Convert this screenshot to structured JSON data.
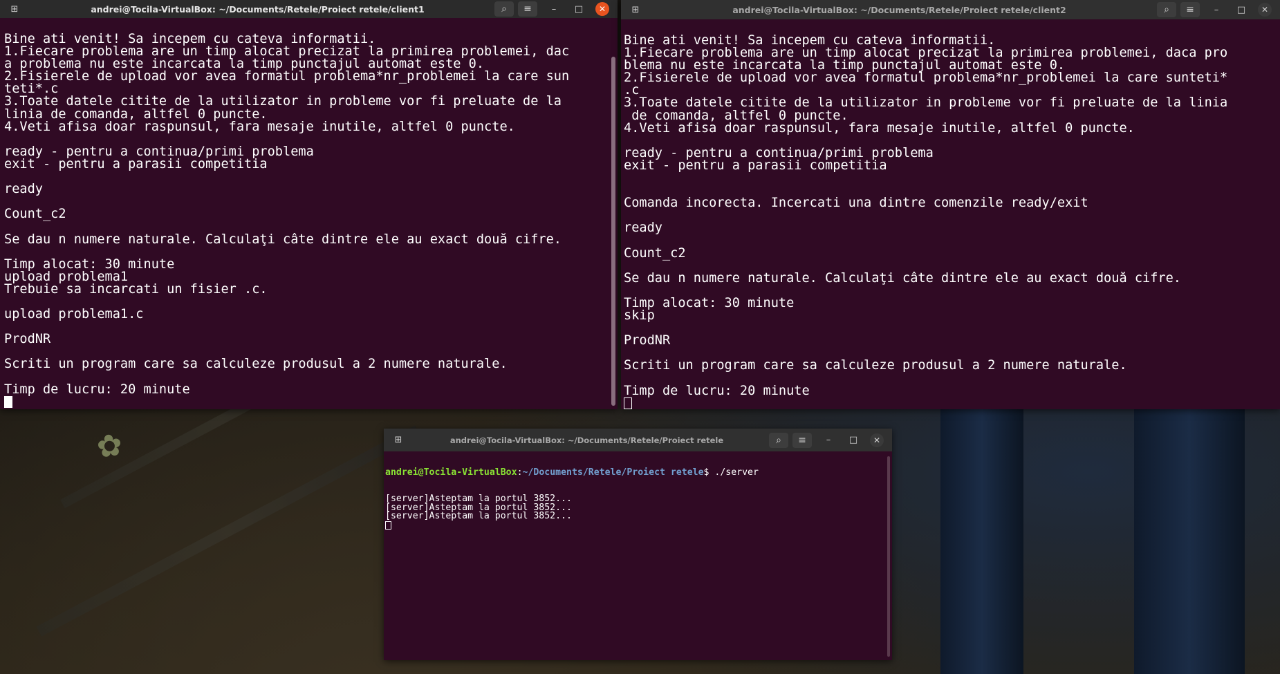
{
  "client1": {
    "title": "andrei@Tocila-VirtualBox: ~/Documents/Retele/Proiect retele/client1",
    "lines": [
      "Bine ati venit! Sa incepem cu cateva informatii.",
      "1.Fiecare problema are un timp alocat precizat la primirea problemei, dac",
      "a problema nu este incarcata la timp punctajul automat este 0.",
      "2.Fisierele de upload vor avea formatul problema*nr_problemei la care sun",
      "teti*.c",
      "3.Toate datele citite de la utilizator in probleme vor fi preluate de la",
      "linia de comanda, altfel 0 puncte.",
      "4.Veti afisa doar raspunsul, fara mesaje inutile, altfel 0 puncte.",
      "",
      "ready - pentru a continua/primi problema",
      "exit - pentru a parasii competitia",
      "",
      "ready",
      "",
      "Count_c2",
      "",
      "Se dau n numere naturale. Calculaţi câte dintre ele au exact două cifre.",
      "",
      "Timp alocat: 30 minute",
      "upload problema1",
      "Trebuie sa incarcati un fisier .c.",
      "",
      "upload problema1.c",
      "",
      "ProdNR",
      "",
      "Scriti un program care sa calculeze produsul a 2 numere naturale.",
      "",
      "Timp de lucru: 20 minute"
    ]
  },
  "client2": {
    "title": "andrei@Tocila-VirtualBox: ~/Documents/Retele/Proiect retele/client2",
    "lines": [
      "Bine ati venit! Sa incepem cu cateva informatii.",
      "1.Fiecare problema are un timp alocat precizat la primirea problemei, daca pro",
      "blema nu este incarcata la timp punctajul automat este 0.",
      "2.Fisierele de upload vor avea formatul problema*nr_problemei la care sunteti*",
      ".c",
      "3.Toate datele citite de la utilizator in probleme vor fi preluate de la linia",
      " de comanda, altfel 0 puncte.",
      "4.Veti afisa doar raspunsul, fara mesaje inutile, altfel 0 puncte.",
      "",
      "ready - pentru a continua/primi problema",
      "exit - pentru a parasii competitia",
      "",
      "",
      "Comanda incorecta. Incercati una dintre comenzile ready/exit",
      "",
      "ready",
      "",
      "Count_c2",
      "",
      "Se dau n numere naturale. Calculaţi câte dintre ele au exact două cifre.",
      "",
      "Timp alocat: 30 minute",
      "skip",
      "",
      "ProdNR",
      "",
      "Scriti un program care sa calculeze produsul a 2 numere naturale.",
      "",
      "Timp de lucru: 20 minute"
    ]
  },
  "server": {
    "title": "andrei@Tocila-VirtualBox: ~/Documents/Retele/Proiect retele",
    "prompt_user": "andrei@Tocila-VirtualBox",
    "prompt_sep": ":",
    "prompt_path": "~/Documents/Retele/Proiect retele",
    "prompt_symbol": "$",
    "command": " ./server",
    "lines": [
      "[server]Asteptam la portul 3852...",
      "[server]Asteptam la portul 3852...",
      "[server]Asteptam la portul 3852..."
    ]
  },
  "icons": {
    "new_tab": "new-tab-icon",
    "search": "search-icon",
    "menu": "hamburger-menu-icon",
    "minimize": "minimize-icon",
    "maximize": "maximize-icon",
    "close": "close-icon"
  },
  "colors": {
    "terminal_bg": "#300a24",
    "titlebar_active": "#2b2b2b",
    "titlebar_inactive": "#303030",
    "close_active": "#e95420",
    "prompt_user": "#8ae234",
    "prompt_path": "#729fcf"
  }
}
